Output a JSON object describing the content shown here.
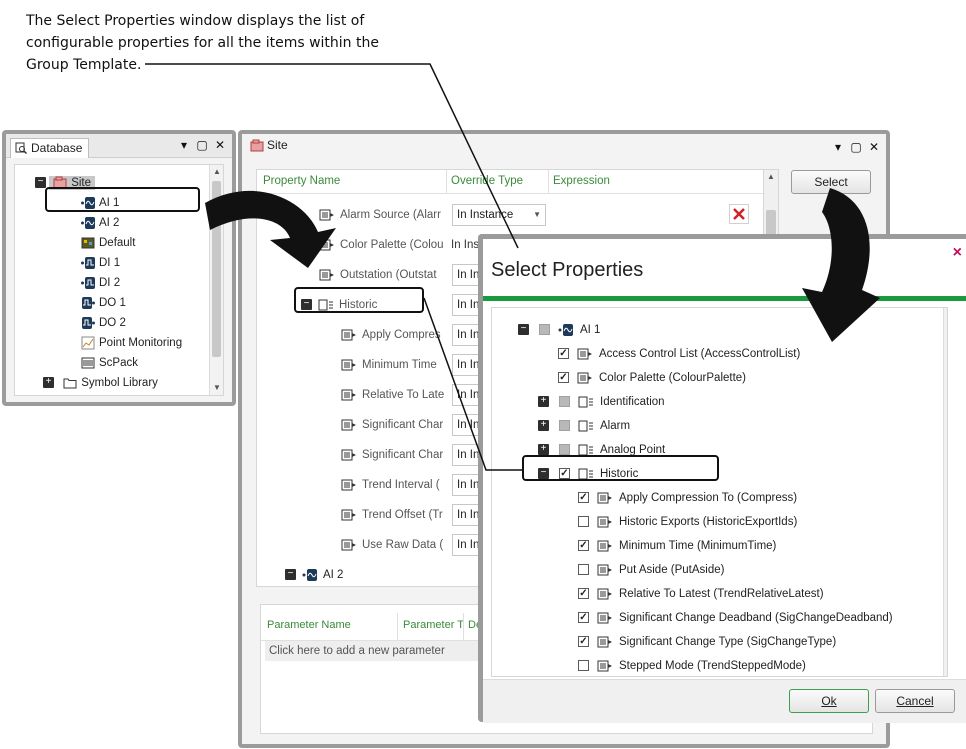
{
  "callout": {
    "text": "The Select Properties window displays the list of configurable properties for all the items within the Group Template."
  },
  "database": {
    "tab_label": "Database",
    "controls": [
      "▾",
      "▢",
      "✕"
    ],
    "items": [
      {
        "label": "Site",
        "icon": "site-icon",
        "expander": "−"
      },
      {
        "label": "AI 1",
        "icon": "analog-point-icon"
      },
      {
        "label": "AI 2",
        "icon": "analog-point-icon"
      },
      {
        "label": "Default",
        "icon": "palette-icon"
      },
      {
        "label": "DI 1",
        "icon": "digital-point-icon"
      },
      {
        "label": "DI 2",
        "icon": "digital-point-icon"
      },
      {
        "label": "DO 1",
        "icon": "digital-output-icon"
      },
      {
        "label": "DO 2",
        "icon": "digital-output-icon"
      },
      {
        "label": "Point Monitoring",
        "icon": "trend-icon"
      },
      {
        "label": "ScPack",
        "icon": "pack-icon"
      },
      {
        "label": "Symbol Library",
        "icon": "folder-icon",
        "expander": "+"
      }
    ]
  },
  "site": {
    "title": "Site",
    "controls": [
      "▾",
      "▢",
      "✕"
    ],
    "columns": [
      "Property Name",
      "Override Type",
      "Expression"
    ],
    "select_label": "Select",
    "rows": [
      {
        "name": "Alarm Source (Alarr",
        "override": "In Instance",
        "has_delete": true
      },
      {
        "name": "Color Palette (Colou",
        "override": "In Insta",
        "has_delete": true
      },
      {
        "name": "Outstation (Outstat",
        "override": "In In"
      },
      {
        "name": "Historic",
        "override": "In In",
        "expander": "−"
      },
      {
        "name": "Apply Compres",
        "override": "In In"
      },
      {
        "name": "Minimum Time",
        "override": "In In"
      },
      {
        "name": "Relative To Late",
        "override": "In In"
      },
      {
        "name": "Significant Char",
        "override": "In In"
      },
      {
        "name": "Significant Char",
        "override": "In In"
      },
      {
        "name": "Trend Interval (",
        "override": "In In"
      },
      {
        "name": "Trend Offset (Tr",
        "override": "In In"
      },
      {
        "name": "Use Raw Data (",
        "override": "In In"
      }
    ],
    "ai2_label": "AI 2",
    "params": {
      "columns": [
        "Parameter Name",
        "Parameter T",
        "De"
      ],
      "new_row": "Click here to add a new parameter"
    }
  },
  "dialog": {
    "title": "Select Properties",
    "close": "×",
    "rows": [
      {
        "label": "AI 1",
        "check": "gray",
        "expander": "−",
        "icon": "analog-point-icon",
        "indent": 0
      },
      {
        "label": "Access Control List (AccessControlList)",
        "check": "checked",
        "icon": "property-icon",
        "indent": 1
      },
      {
        "label": "Color Palette (ColourPalette)",
        "check": "checked",
        "icon": "property-icon",
        "indent": 1
      },
      {
        "label": "Identification",
        "check": "gray",
        "expander": "+",
        "icon": "group-icon",
        "indent": 1
      },
      {
        "label": "Alarm",
        "check": "gray",
        "expander": "+",
        "icon": "group-icon",
        "indent": 1
      },
      {
        "label": "Analog Point",
        "check": "gray",
        "expander": "+",
        "icon": "group-icon",
        "indent": 1
      },
      {
        "label": "Historic",
        "check": "checked",
        "expander": "−",
        "icon": "group-icon",
        "indent": 1
      },
      {
        "label": "Apply Compression To (Compress)",
        "check": "checked",
        "icon": "property-icon",
        "indent": 2
      },
      {
        "label": "Historic Exports (HistoricExportIds)",
        "check": "unchecked",
        "icon": "property-icon",
        "indent": 2
      },
      {
        "label": "Minimum Time (MinimumTime)",
        "check": "checked",
        "icon": "property-icon",
        "indent": 2
      },
      {
        "label": "Put Aside (PutAside)",
        "check": "unchecked",
        "icon": "property-icon",
        "indent": 2
      },
      {
        "label": "Relative To Latest (TrendRelativeLatest)",
        "check": "checked",
        "icon": "property-icon",
        "indent": 2
      },
      {
        "label": "Significant Change Deadband (SigChangeDeadband)",
        "check": "checked",
        "icon": "property-icon",
        "indent": 2
      },
      {
        "label": "Significant Change Type (SigChangeType)",
        "check": "checked",
        "icon": "property-icon",
        "indent": 2
      },
      {
        "label": "Stepped Mode (TrendSteppedMode)",
        "check": "unchecked",
        "icon": "property-icon",
        "indent": 2
      }
    ],
    "ok_label": "Ok",
    "cancel_label": "Cancel"
  },
  "colors": {
    "accent_green": "#1a9a3c",
    "close_red": "#c0105a",
    "delete_red": "#d0202a",
    "header_green": "#3a8a3a"
  }
}
